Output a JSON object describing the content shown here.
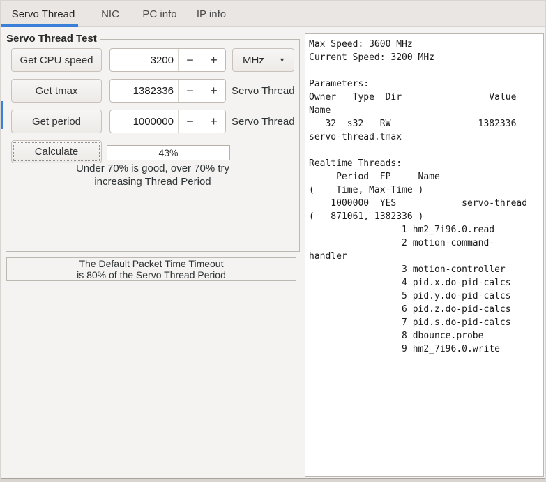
{
  "colors": {
    "accent": "#3b80d8",
    "window_bg": "#f4f3f1"
  },
  "icons": {
    "minus": "−",
    "plus": "+",
    "dropdown": "▼"
  },
  "tab_bar": {
    "tabs": [
      {
        "label": "Servo Thread"
      },
      {
        "label": "NIC"
      },
      {
        "label": "PC info"
      },
      {
        "label": "IP info"
      }
    ]
  },
  "servo_frame": {
    "title": "Servo Thread Test",
    "rows": [
      {
        "button_label": "Get CPU speed",
        "value": "3200",
        "unit": "MHz"
      },
      {
        "button_label": "Get tmax",
        "value": "1382336",
        "unit": "Servo Thread"
      },
      {
        "button_label": "Get period",
        "value": "1000000",
        "unit": "Servo Thread"
      }
    ],
    "calculate_label": "Calculate",
    "percent": "43%",
    "hint_line1": "Under 70% is good, over 70% try",
    "hint_line2": "increasing Thread Period"
  },
  "timeout_frame": {
    "line1": "The Default Packet Time Timeout",
    "line2": "is 80% of the Servo Thread Period"
  },
  "output_panel": {
    "text": "Max Speed: 3600 MHz\nCurrent Speed: 3200 MHz\n\nParameters:\nOwner   Type  Dir                Value\nName\n   32  s32   RW                1382336\nservo-thread.tmax\n\nRealtime Threads:\n     Period  FP     Name\n(    Time, Max-Time )\n    1000000  YES            servo-thread\n(   871061, 1382336 )\n                 1 hm2_7i96.0.read\n                 2 motion-command-\nhandler\n                 3 motion-controller\n                 4 pid.x.do-pid-calcs\n                 5 pid.y.do-pid-calcs\n                 6 pid.z.do-pid-calcs\n                 7 pid.s.do-pid-calcs\n                 8 dbounce.probe\n                 9 hm2_7i96.0.write"
  }
}
